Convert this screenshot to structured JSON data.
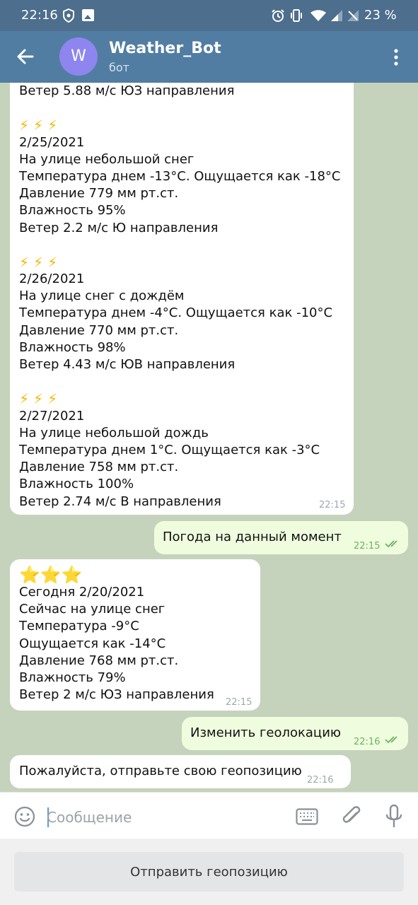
{
  "status_bar": {
    "time": "22:16",
    "battery": "23 %",
    "icons": [
      "shield-icon",
      "image-icon",
      "alarm-icon",
      "vibrate-icon",
      "wifi-icon",
      "signal-icon",
      "no-signal-icon"
    ]
  },
  "header": {
    "avatar_letter": "W",
    "title": "Weather_Bot",
    "subtitle": "бот",
    "avatar_color": "#8e85ee",
    "bar_color": "#527da3"
  },
  "messages": {
    "forecast": {
      "top_line": "Ветер 5.88 м/с ЮЗ направления",
      "days": [
        {
          "emoji": "⚡⚡⚡",
          "date": "2/25/2021",
          "condition": "На улице небольшой снег",
          "temperature": "Температура днем -13°C. Ощущается как -18°C",
          "pressure": "Давление 779 мм рт.ст.",
          "humidity": "Влажность 95%",
          "wind": "Ветер 2.2 м/с Ю направления"
        },
        {
          "emoji": "⚡⚡⚡",
          "date": "2/26/2021",
          "condition": "На улице снег с дождём",
          "temperature": "Температура днем -4°C. Ощущается как -10°C",
          "pressure": "Давление 770 мм рт.ст.",
          "humidity": "Влажность 98%",
          "wind": "Ветер 4.43 м/с ЮВ направления"
        },
        {
          "emoji": "⚡⚡⚡",
          "date": "2/27/2021",
          "condition": "На улице небольшой дождь",
          "temperature": "Температура днем 1°C. Ощущается как -3°C",
          "pressure": "Давление 758 мм рт.ст.",
          "humidity": "Влажность 100%",
          "wind": "Ветер 2.74 м/с В направления"
        }
      ],
      "time": "22:15"
    },
    "out_current": {
      "text": "Погода на данный момент",
      "time": "22:15"
    },
    "current": {
      "emoji": "⭐⭐⭐",
      "date_line": "Сегодня 2/20/2021",
      "condition": "Сейчас на улице снег",
      "temperature": "Температура -9°C",
      "feels_like": "Ощущается как -14°C",
      "pressure": "Давление 768 мм рт.ст.",
      "humidity": "Влажность 79%",
      "wind": "Ветер 2 м/с ЮЗ направления",
      "time": "22:15"
    },
    "out_geo": {
      "text": "Изменить геолокацию",
      "time": "22:16"
    },
    "geo_prompt": {
      "text": "Пожалуйста, отправьте свою геопозицию",
      "time": "22:16"
    }
  },
  "input": {
    "placeholder": "Сообщение"
  },
  "keyboard_button": {
    "label": "Отправить геопозицию"
  }
}
